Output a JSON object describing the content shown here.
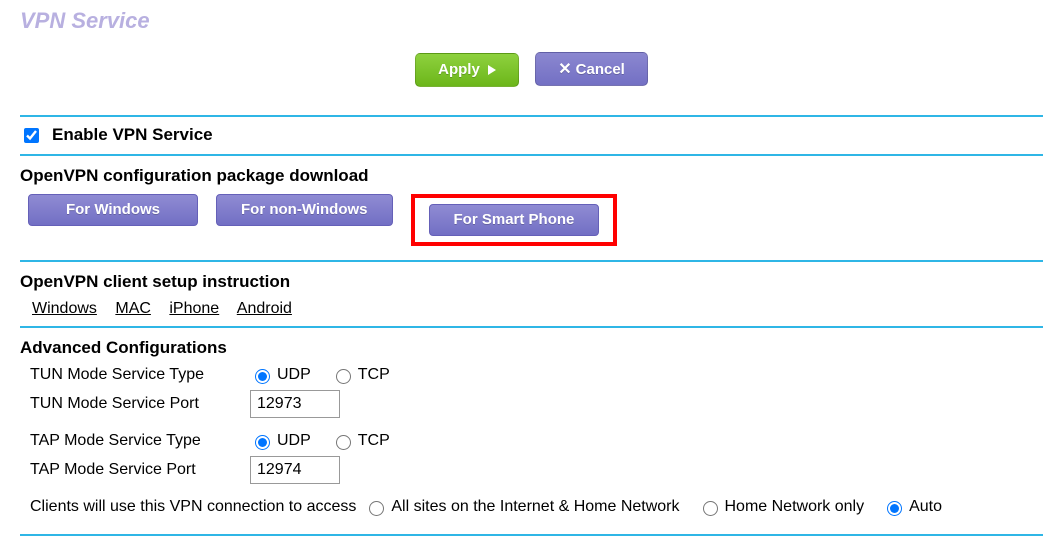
{
  "title": "VPN Service",
  "buttons": {
    "apply": "Apply",
    "cancel": "Cancel"
  },
  "enable": {
    "label": "Enable VPN Service",
    "checked": true
  },
  "download": {
    "heading": "OpenVPN configuration package download",
    "windows": "For Windows",
    "nonwindows": "For non-Windows",
    "smartphone": "For Smart Phone"
  },
  "setup": {
    "heading": "OpenVPN client setup instruction",
    "links": {
      "windows": "Windows",
      "mac": "MAC",
      "iphone": "iPhone",
      "android": "Android"
    }
  },
  "advanced": {
    "heading": "Advanced Configurations",
    "tun_type_label": "TUN Mode Service Type",
    "tun_port_label": "TUN Mode Service Port",
    "tun_port_value": "12973",
    "tap_type_label": "TAP Mode Service Type",
    "tap_port_label": "TAP Mode Service Port",
    "tap_port_value": "12974",
    "udp": "UDP",
    "tcp": "TCP",
    "tun_type_selected": "udp",
    "tap_type_selected": "udp",
    "access_label": "Clients will use this VPN connection to access",
    "access_all": "All sites on the Internet & Home Network",
    "access_home": "Home Network only",
    "access_auto": "Auto",
    "access_selected": "auto"
  }
}
